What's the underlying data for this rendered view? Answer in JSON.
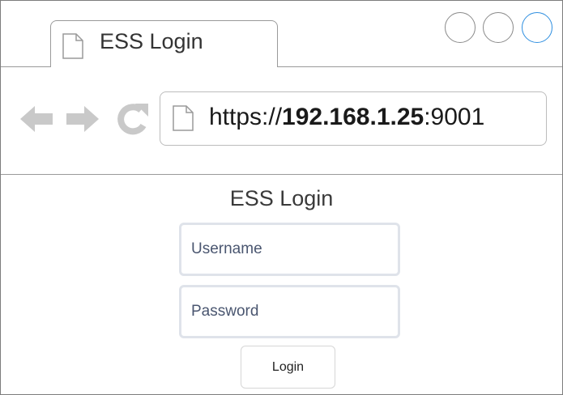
{
  "tab": {
    "title": "ESS Login",
    "icon": "page-icon"
  },
  "window_controls": [
    {
      "name": "minimize",
      "icon": "circle-button-icon"
    },
    {
      "name": "maximize",
      "icon": "circle-button-icon"
    },
    {
      "name": "close",
      "icon": "circle-button-icon",
      "accent": "#2f8fe0"
    }
  ],
  "toolbar": {
    "back_icon": "arrow-left-icon",
    "forward_icon": "arrow-right-icon",
    "reload_icon": "reload-icon"
  },
  "address": {
    "scheme": "https://",
    "host": "192.168.1.25",
    "port": ":9001",
    "icon": "page-icon"
  },
  "login": {
    "title": "ESS Login",
    "username_placeholder": "Username",
    "password_placeholder": "Password",
    "button_label": "Login"
  }
}
